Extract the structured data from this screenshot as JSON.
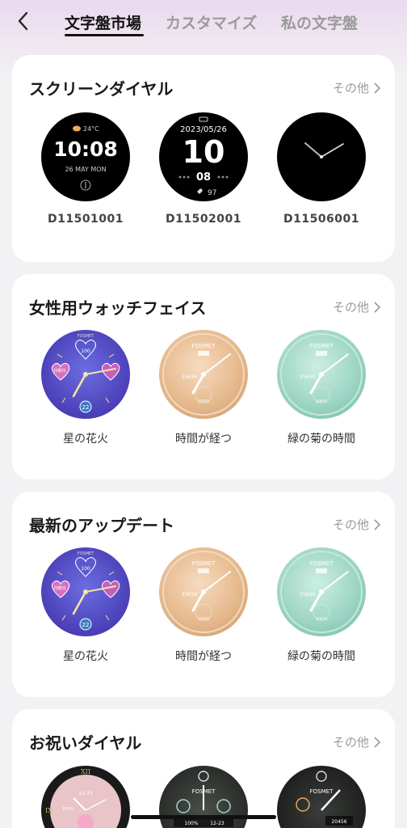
{
  "header": {
    "tabs": [
      {
        "label": "文字盤市場",
        "active": true
      },
      {
        "label": "カスタマイズ",
        "active": false
      },
      {
        "label": "私の文字盤",
        "active": false
      }
    ]
  },
  "sections": [
    {
      "title": "スクリーンダイヤル",
      "more": "その他",
      "items": [
        {
          "label": "D11501001",
          "weather": "24°C",
          "time": "10:08",
          "date": "26 MAY MON"
        },
        {
          "label": "D11502001",
          "date": "2023/05/26",
          "hour": "10",
          "minute": "08",
          "heart": "97"
        },
        {
          "label": "D11506001"
        }
      ]
    },
    {
      "title": "女性用ウォッチフェイス",
      "more": "その他",
      "items": [
        {
          "label": "星の花火",
          "brand": "FOSMET",
          "day": "月曜日",
          "steps": "100",
          "value": "22"
        },
        {
          "label": "時間が経つ",
          "brand": "FOSMET",
          "steps": "25634",
          "percent": "100%"
        },
        {
          "label": "緑の菊の時間",
          "brand": "FOSMET",
          "steps": "25634",
          "percent": "100%"
        }
      ]
    },
    {
      "title": "最新のアップデート",
      "more": "その他",
      "items": [
        {
          "label": "星の花火",
          "brand": "FOSMET",
          "day": "月曜日",
          "steps": "100",
          "value": "22"
        },
        {
          "label": "時間が経つ",
          "brand": "FOSMET",
          "steps": "25634",
          "percent": "100%"
        },
        {
          "label": "緑の菊の時間",
          "brand": "FOSMET",
          "steps": "25634",
          "percent": "100%"
        }
      ]
    },
    {
      "title": "お祝いダイヤル",
      "more": "その他",
      "items": [
        {
          "numeral_top": "XII",
          "numeral_left": "IX",
          "date": "12-23",
          "percent": "100%"
        },
        {
          "brand": "FOSMET",
          "percent": "100%",
          "date": "12-23"
        },
        {
          "brand": "FOSMET",
          "steps": "20456"
        }
      ]
    }
  ]
}
